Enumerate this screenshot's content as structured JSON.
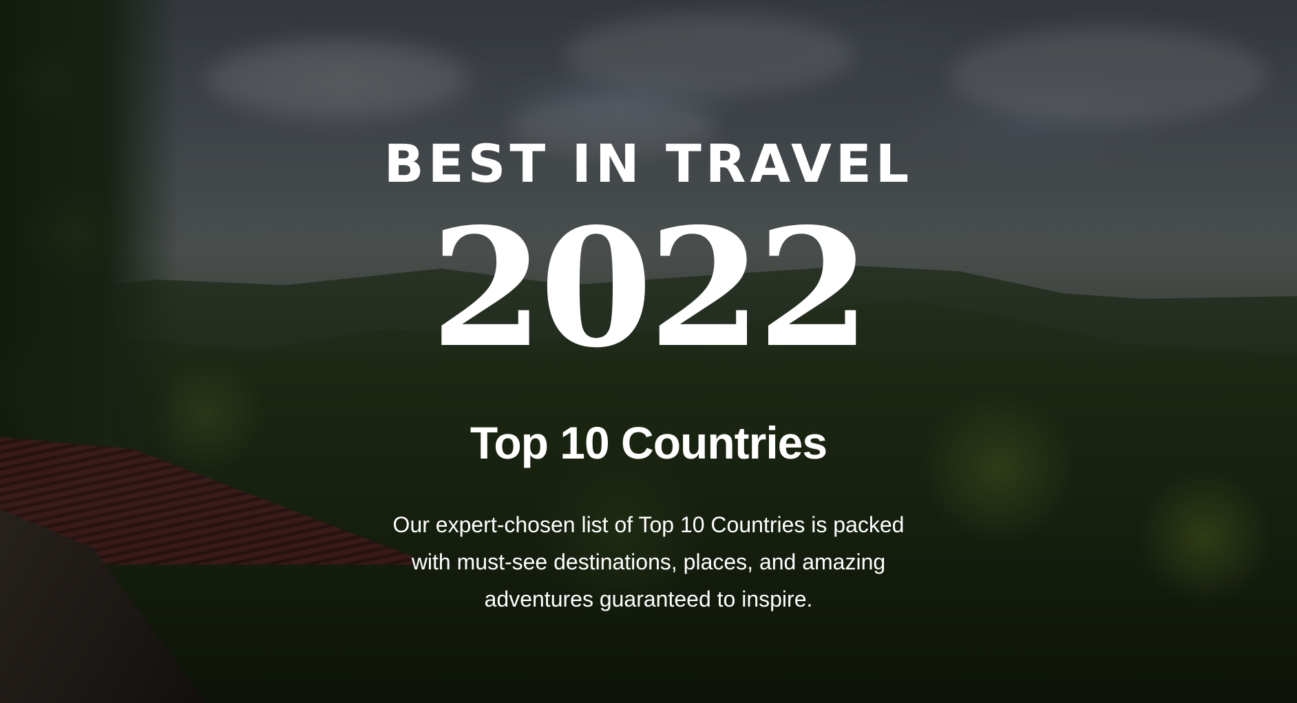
{
  "hero": {
    "eyebrow": "BEST IN TRAVEL",
    "year": "2022",
    "headline": "Top 10 Countries",
    "description": "Our expert-chosen list of Top 10 Countries is packed with must-see destinations, places, and amazing adventures guaranteed to inspire."
  }
}
